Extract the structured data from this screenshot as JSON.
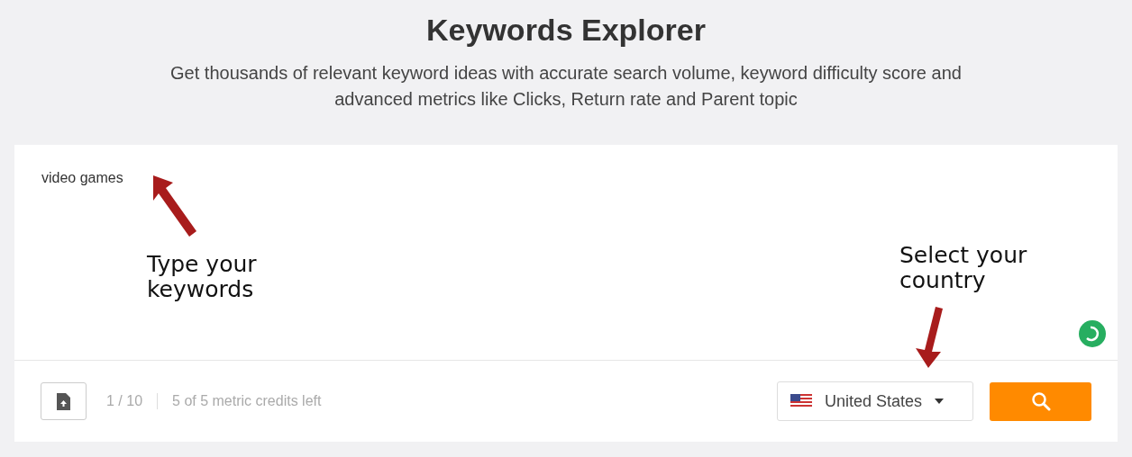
{
  "header": {
    "title": "Keywords Explorer",
    "subtitle": "Get thousands of relevant keyword ideas with accurate search volume, keyword difficulty score and advanced metrics like Clicks, Return rate and Parent topic"
  },
  "search_box": {
    "value": "video games"
  },
  "annotations": [
    {
      "kind": "left",
      "text": "Type your keywords"
    },
    {
      "kind": "right",
      "text": "Select your country"
    }
  ],
  "footer": {
    "keyword_count": "1 / 10",
    "credits": "5 of 5 metric credits left",
    "country": "United States"
  }
}
